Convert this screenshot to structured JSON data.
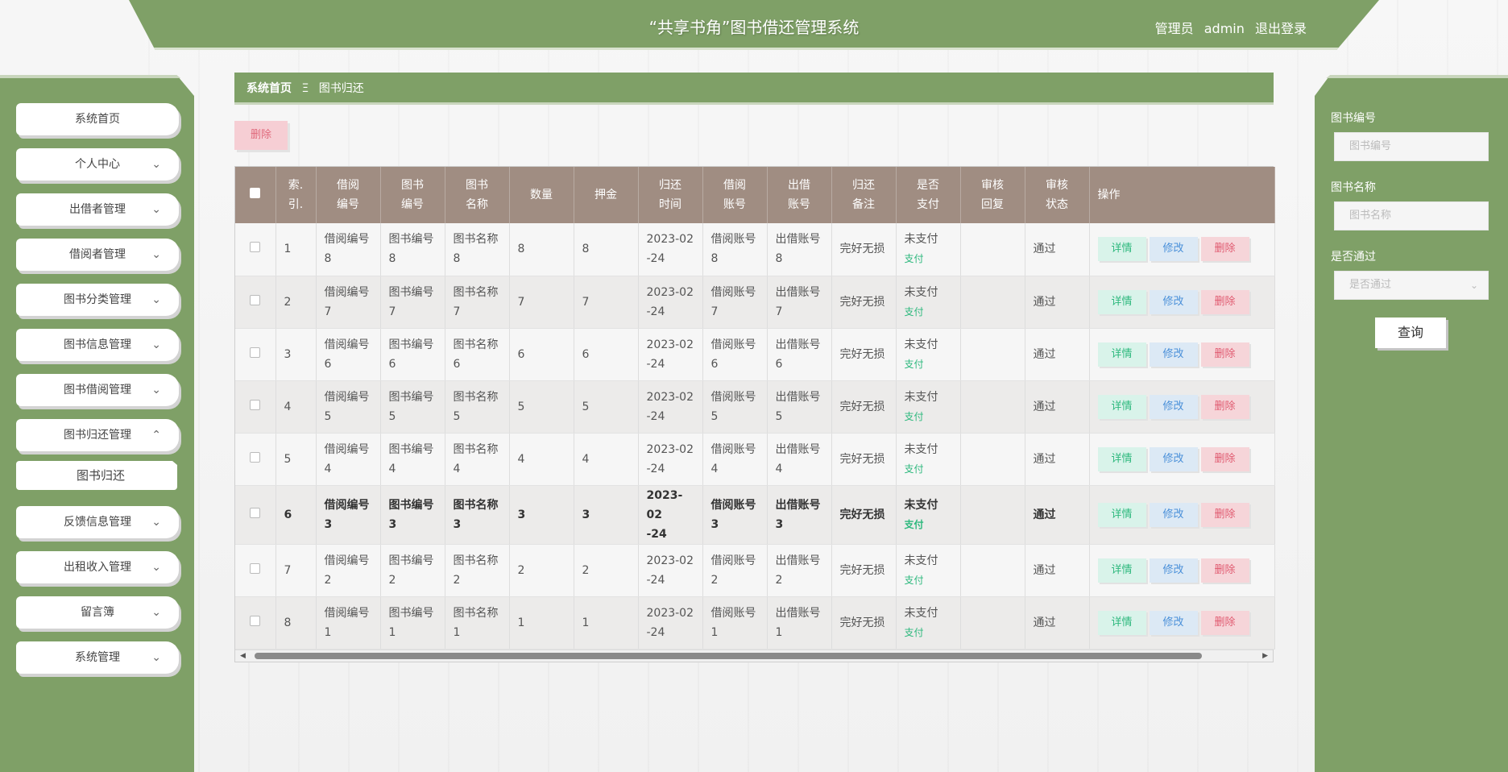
{
  "header": {
    "title": "“共享书角”图书借还管理系统",
    "user_role": "管理员",
    "username": "admin",
    "logout": "退出登录"
  },
  "sidebar": {
    "items": [
      {
        "label": "系统首页",
        "chevron": ""
      },
      {
        "label": "个人中心",
        "chevron": "chevron-down"
      },
      {
        "label": "出借者管理",
        "chevron": "chevron-down"
      },
      {
        "label": "借阅者管理",
        "chevron": "chevron-down"
      },
      {
        "label": "图书分类管理",
        "chevron": "chevron-down"
      },
      {
        "label": "图书信息管理",
        "chevron": "chevron-down"
      },
      {
        "label": "图书借阅管理",
        "chevron": "chevron-down"
      },
      {
        "label": "图书归还管理",
        "chevron": "chevron-up"
      },
      {
        "label": "图书归还",
        "chevron": ""
      },
      {
        "label": "反馈信息管理",
        "chevron": "chevron-down"
      },
      {
        "label": "出租收入管理",
        "chevron": "chevron-down"
      },
      {
        "label": "留言簿",
        "chevron": "chevron-down"
      },
      {
        "label": "系统管理",
        "chevron": "chevron-down"
      }
    ]
  },
  "breadcrumb": {
    "home": "系统首页",
    "separator": "Ξ",
    "current": "图书归还"
  },
  "toolbar": {
    "delete_label": "删除"
  },
  "table": {
    "headers": [
      "",
      "索引",
      "借阅编号",
      "图书编号",
      "图书名称",
      "数量",
      "押金",
      "归还时间",
      "借阅账号",
      "出借账号",
      "归还备注",
      "是否支付",
      "审核回复",
      "审核状态",
      "操作"
    ],
    "header_lines": [
      [
        "",
        ""
      ],
      [
        "索.",
        "引."
      ],
      [
        "借阅",
        "编号"
      ],
      [
        "图书",
        "编号"
      ],
      [
        "图书",
        "名称"
      ],
      [
        "数量",
        ""
      ],
      [
        "押金",
        ""
      ],
      [
        "归还",
        "时间"
      ],
      [
        "借阅",
        "账号"
      ],
      [
        "出借",
        "账号"
      ],
      [
        "归还",
        "备注"
      ],
      [
        "是否",
        "支付"
      ],
      [
        "审核",
        "回复"
      ],
      [
        "审核",
        "状态"
      ],
      [
        "操作",
        ""
      ]
    ],
    "rows": [
      {
        "index": "1",
        "borrow_no_a": "借阅编号",
        "borrow_no_b": "8",
        "book_no_a": "图书编号",
        "book_no_b": "8",
        "book_name_a": "图书名称",
        "book_name_b": "8",
        "qty": "8",
        "deposit": "8",
        "date_a": "2023-02",
        "date_b": "-24",
        "borrower_a": "借阅账号",
        "borrower_b": "8",
        "lender_a": "出借账号",
        "lender_b": "8",
        "note": "完好无损",
        "paid": "未支付",
        "pay_link": "支付",
        "reply": "",
        "status": "通过"
      },
      {
        "index": "2",
        "borrow_no_a": "借阅编号",
        "borrow_no_b": "7",
        "book_no_a": "图书编号",
        "book_no_b": "7",
        "book_name_a": "图书名称",
        "book_name_b": "7",
        "qty": "7",
        "deposit": "7",
        "date_a": "2023-02",
        "date_b": "-24",
        "borrower_a": "借阅账号",
        "borrower_b": "7",
        "lender_a": "出借账号",
        "lender_b": "7",
        "note": "完好无损",
        "paid": "未支付",
        "pay_link": "支付",
        "reply": "",
        "status": "通过"
      },
      {
        "index": "3",
        "borrow_no_a": "借阅编号",
        "borrow_no_b": "6",
        "book_no_a": "图书编号",
        "book_no_b": "6",
        "book_name_a": "图书名称",
        "book_name_b": "6",
        "qty": "6",
        "deposit": "6",
        "date_a": "2023-02",
        "date_b": "-24",
        "borrower_a": "借阅账号",
        "borrower_b": "6",
        "lender_a": "出借账号",
        "lender_b": "6",
        "note": "完好无损",
        "paid": "未支付",
        "pay_link": "支付",
        "reply": "",
        "status": "通过"
      },
      {
        "index": "4",
        "borrow_no_a": "借阅编号",
        "borrow_no_b": "5",
        "book_no_a": "图书编号",
        "book_no_b": "5",
        "book_name_a": "图书名称",
        "book_name_b": "5",
        "qty": "5",
        "deposit": "5",
        "date_a": "2023-02",
        "date_b": "-24",
        "borrower_a": "借阅账号",
        "borrower_b": "5",
        "lender_a": "出借账号",
        "lender_b": "5",
        "note": "完好无损",
        "paid": "未支付",
        "pay_link": "支付",
        "reply": "",
        "status": "通过"
      },
      {
        "index": "5",
        "borrow_no_a": "借阅编号",
        "borrow_no_b": "4",
        "book_no_a": "图书编号",
        "book_no_b": "4",
        "book_name_a": "图书名称",
        "book_name_b": "4",
        "qty": "4",
        "deposit": "4",
        "date_a": "2023-02",
        "date_b": "-24",
        "borrower_a": "借阅账号",
        "borrower_b": "4",
        "lender_a": "出借账号",
        "lender_b": "4",
        "note": "完好无损",
        "paid": "未支付",
        "pay_link": "支付",
        "reply": "",
        "status": "通过"
      },
      {
        "index": "6",
        "borrow_no_a": "借阅编号",
        "borrow_no_b": "3",
        "book_no_a": "图书编号",
        "book_no_b": "3",
        "book_name_a": "图书名称",
        "book_name_b": "3",
        "qty": "3",
        "deposit": "3",
        "date_a": "2023-02",
        "date_b": "-24",
        "borrower_a": "借阅账号",
        "borrower_b": "3",
        "lender_a": "出借账号",
        "lender_b": "3",
        "note": "完好无损",
        "paid": "未支付",
        "pay_link": "支付",
        "reply": "",
        "status": "通过"
      },
      {
        "index": "7",
        "borrow_no_a": "借阅编号",
        "borrow_no_b": "2",
        "book_no_a": "图书编号",
        "book_no_b": "2",
        "book_name_a": "图书名称",
        "book_name_b": "2",
        "qty": "2",
        "deposit": "2",
        "date_a": "2023-02",
        "date_b": "-24",
        "borrower_a": "借阅账号",
        "borrower_b": "2",
        "lender_a": "出借账号",
        "lender_b": "2",
        "note": "完好无损",
        "paid": "未支付",
        "pay_link": "支付",
        "reply": "",
        "status": "通过"
      },
      {
        "index": "8",
        "borrow_no_a": "借阅编号",
        "borrow_no_b": "1",
        "book_no_a": "图书编号",
        "book_no_b": "1",
        "book_name_a": "图书名称",
        "book_name_b": "1",
        "qty": "1",
        "deposit": "1",
        "date_a": "2023-02",
        "date_b": "-24",
        "borrower_a": "借阅账号",
        "borrower_b": "1",
        "lender_a": "出借账号",
        "lender_b": "1",
        "note": "完好无损",
        "paid": "未支付",
        "pay_link": "支付",
        "reply": "",
        "status": "通过"
      }
    ],
    "actions": {
      "detail": "详情",
      "edit": "修改",
      "delete": "删除"
    }
  },
  "search": {
    "book_no_label": "图书编号",
    "book_no_placeholder": "图书编号",
    "book_name_label": "图书名称",
    "book_name_placeholder": "图书名称",
    "approved_label": "是否通过",
    "approved_placeholder": "是否通过",
    "submit_label": "查询"
  },
  "colors": {
    "brand_green": "#7fa067",
    "table_header": "#a08d82",
    "detail_text": "#2db87d",
    "edit_text": "#4a90d9",
    "delete_text": "#e05a70"
  }
}
